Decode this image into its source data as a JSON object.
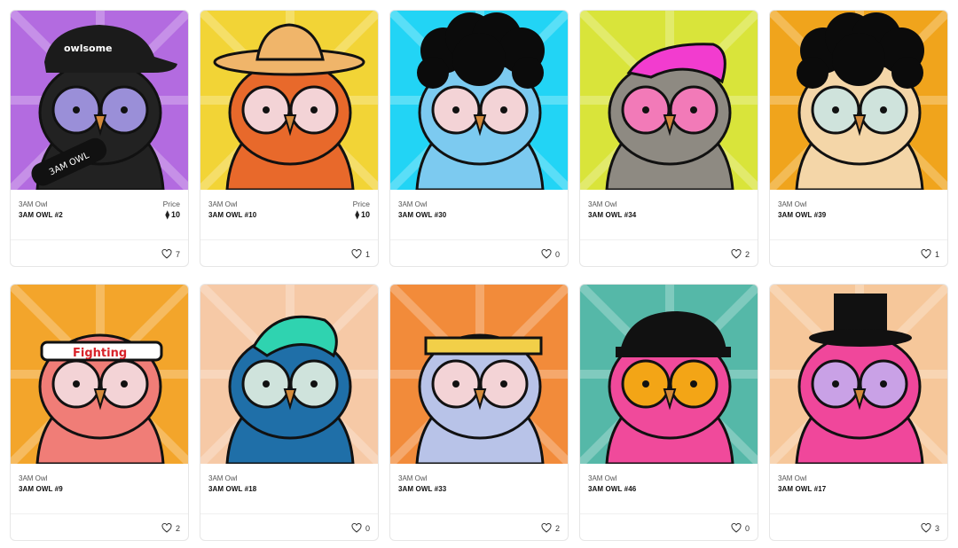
{
  "cards": [
    {
      "collection": "3AM Owl",
      "name": "3AM OWL #2",
      "price_label": "Price",
      "price": "10",
      "likes": "7",
      "bg": "#b36be0",
      "accent": "#222222",
      "eye": "#9a8fd8",
      "hat": "black-cap",
      "hat_text": "owlsome",
      "board_text": "3AM OWL"
    },
    {
      "collection": "3AM Owl",
      "name": "3AM OWL #10",
      "price_label": "Price",
      "price": "10",
      "likes": "1",
      "bg": "#f2d436",
      "accent": "#e8692b",
      "eye": "#f3d3d6",
      "hat": "sombrero"
    },
    {
      "collection": "3AM Owl",
      "name": "3AM OWL #30",
      "likes": "0",
      "bg": "#22d4f5",
      "accent": "#7ccaf0",
      "eye": "#f3d3d6",
      "hat": "afro"
    },
    {
      "collection": "3AM Owl",
      "name": "3AM OWL #34",
      "likes": "2",
      "bg": "#d9e43a",
      "accent": "#8e8a82",
      "eye": "#f27ab8",
      "hat": "pink-hair"
    },
    {
      "collection": "3AM Owl",
      "name": "3AM OWL #39",
      "likes": "1",
      "bg": "#f0a41c",
      "accent": "#f4d6a8",
      "eye": "#cfe3dc",
      "hat": "afro"
    },
    {
      "collection": "3AM Owl",
      "name": "3AM OWL #9",
      "likes": "2",
      "bg": "#f3a52b",
      "accent": "#f07d77",
      "eye": "#f3d3d6",
      "hat": "headband",
      "hat_text": "Fighting"
    },
    {
      "collection": "3AM Owl",
      "name": "3AM OWL #18",
      "likes": "0",
      "bg": "#f6c9a6",
      "accent": "#1f6fa8",
      "eye": "#cfe3dc",
      "hat": "teal-hair"
    },
    {
      "collection": "3AM Owl",
      "name": "3AM OWL #33",
      "likes": "2",
      "bg": "#f28b3a",
      "accent": "#b8c3e8",
      "eye": "#f3d3d6",
      "hat": "bandana"
    },
    {
      "collection": "3AM Owl",
      "name": "3AM OWL #46",
      "likes": "0",
      "bg": "#55b8a8",
      "accent": "#f04a9b",
      "eye": "#f3a516",
      "hat": "captain"
    },
    {
      "collection": "3AM Owl",
      "name": "3AM OWL #17",
      "likes": "3",
      "bg": "#f6c79a",
      "accent": "#f0479b",
      "eye": "#c9a1e6",
      "hat": "top-hat"
    }
  ],
  "icons": {
    "heart": "heart-icon",
    "currency": "ethereum-icon"
  }
}
